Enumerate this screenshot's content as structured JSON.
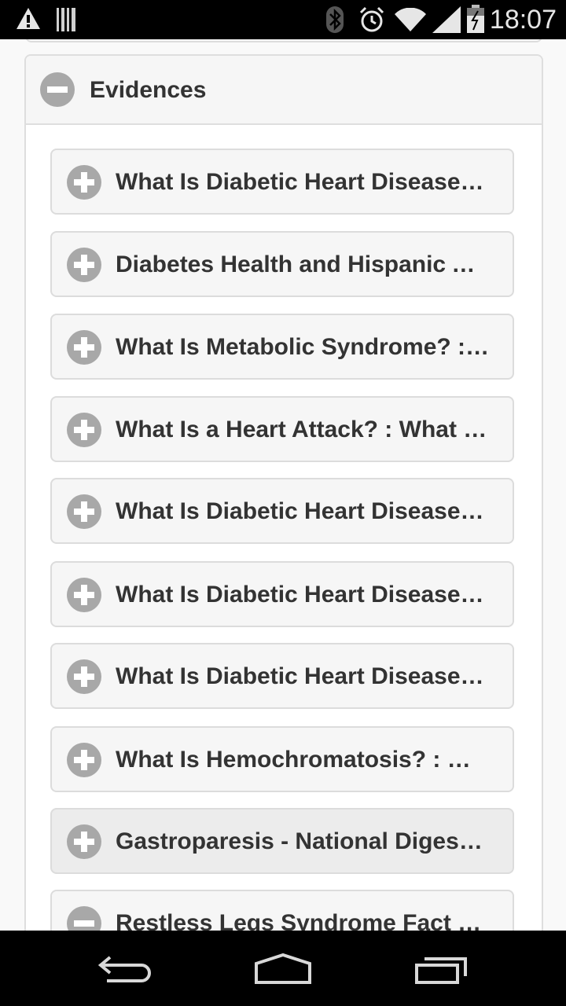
{
  "status_bar": {
    "time": "18:07",
    "icons": [
      "warning-icon",
      "barcode-icon",
      "bluetooth-icon",
      "alarm-icon",
      "wifi-icon",
      "signal-icon",
      "battery-icon"
    ]
  },
  "section": {
    "title": "Evidences",
    "expanded": true
  },
  "items": [
    {
      "label": "What Is Diabetic Heart Disease? : What Is Diabetic Heart Disease?",
      "expanded": false
    },
    {
      "label": "Diabetes Health and Hispanic Americans",
      "expanded": false
    },
    {
      "label": "What Is Metabolic Syndrome? : What Is Metabolic Syndrome?",
      "expanded": false
    },
    {
      "label": "What Is a Heart Attack? : What Is a Heart Attack?",
      "expanded": false
    },
    {
      "label": "What Is Diabetic Heart Disease? : Who Is at Risk?",
      "expanded": false
    },
    {
      "label": "What Is Diabetic Heart Disease? : Signs and Symptoms",
      "expanded": false
    },
    {
      "label": "What Is Diabetic Heart Disease? : Diagnosis",
      "expanded": false
    },
    {
      "label": "What Is Hemochromatosis? : What Is Hemochromatosis?",
      "expanded": false
    },
    {
      "label": "Gastroparesis - National Digestive Diseases Information Clearinghouse",
      "expanded": false
    },
    {
      "label": "Restless Legs Syndrome Fact Sheet",
      "expanded": true
    }
  ],
  "colors": {
    "icon_fill": "#a8a8a8",
    "header_bg": "#f6f6f6",
    "active_item_bg": "#ececec",
    "text": "#333333"
  },
  "nav": {
    "back": "back-icon",
    "home": "home-icon",
    "recents": "recents-icon"
  }
}
